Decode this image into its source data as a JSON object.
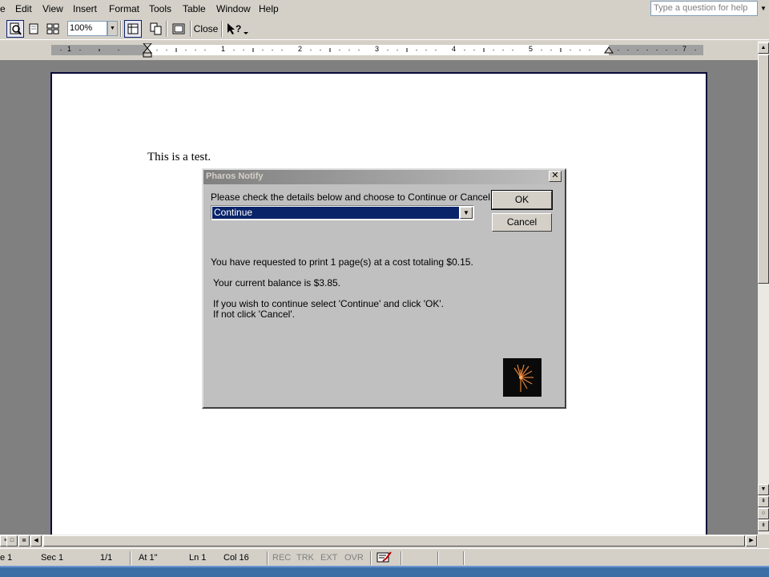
{
  "menu": {
    "items": [
      {
        "label": "e"
      },
      {
        "label": "Edit"
      },
      {
        "label": "View"
      },
      {
        "label": "Insert"
      },
      {
        "label": "Format"
      },
      {
        "label": "Tools"
      },
      {
        "label": "Table"
      },
      {
        "label": "Window"
      },
      {
        "label": "Help"
      }
    ],
    "help_placeholder": "Type a question for help"
  },
  "toolbar": {
    "zoom": "100%",
    "close_label": "Close"
  },
  "ruler": {
    "numbers": [
      "1",
      "1",
      "2",
      "3",
      "4",
      "5",
      "7"
    ]
  },
  "document": {
    "text": "This is a test."
  },
  "dialog": {
    "title": "Pharos Notify",
    "prompt": "Please check the details below and choose to Continue or Cancel.",
    "selected_option": "Continue",
    "ok_label": "OK",
    "cancel_label": "Cancel",
    "cost_line": "You have requested to print 1 page(s) at a cost totaling $0.15.",
    "balance_line": "Your current balance is $3.85.",
    "continue_line": "If you wish to continue select 'Continue' and click 'OK'.",
    "cancel_line": "If not click 'Cancel'."
  },
  "statusbar": {
    "page": "e  1",
    "sec": "Sec  1",
    "pages": "1/1",
    "at": "At  1\"",
    "ln": "Ln  1",
    "col": "Col  16",
    "rec": "REC",
    "trk": "TRK",
    "ext": "EXT",
    "ovr": "OVR"
  },
  "colors": {
    "selection": "#0a246a",
    "dialog_bg": "#c0c0c0",
    "chrome": "#d4d0c8",
    "doc_bg": "#808080"
  }
}
